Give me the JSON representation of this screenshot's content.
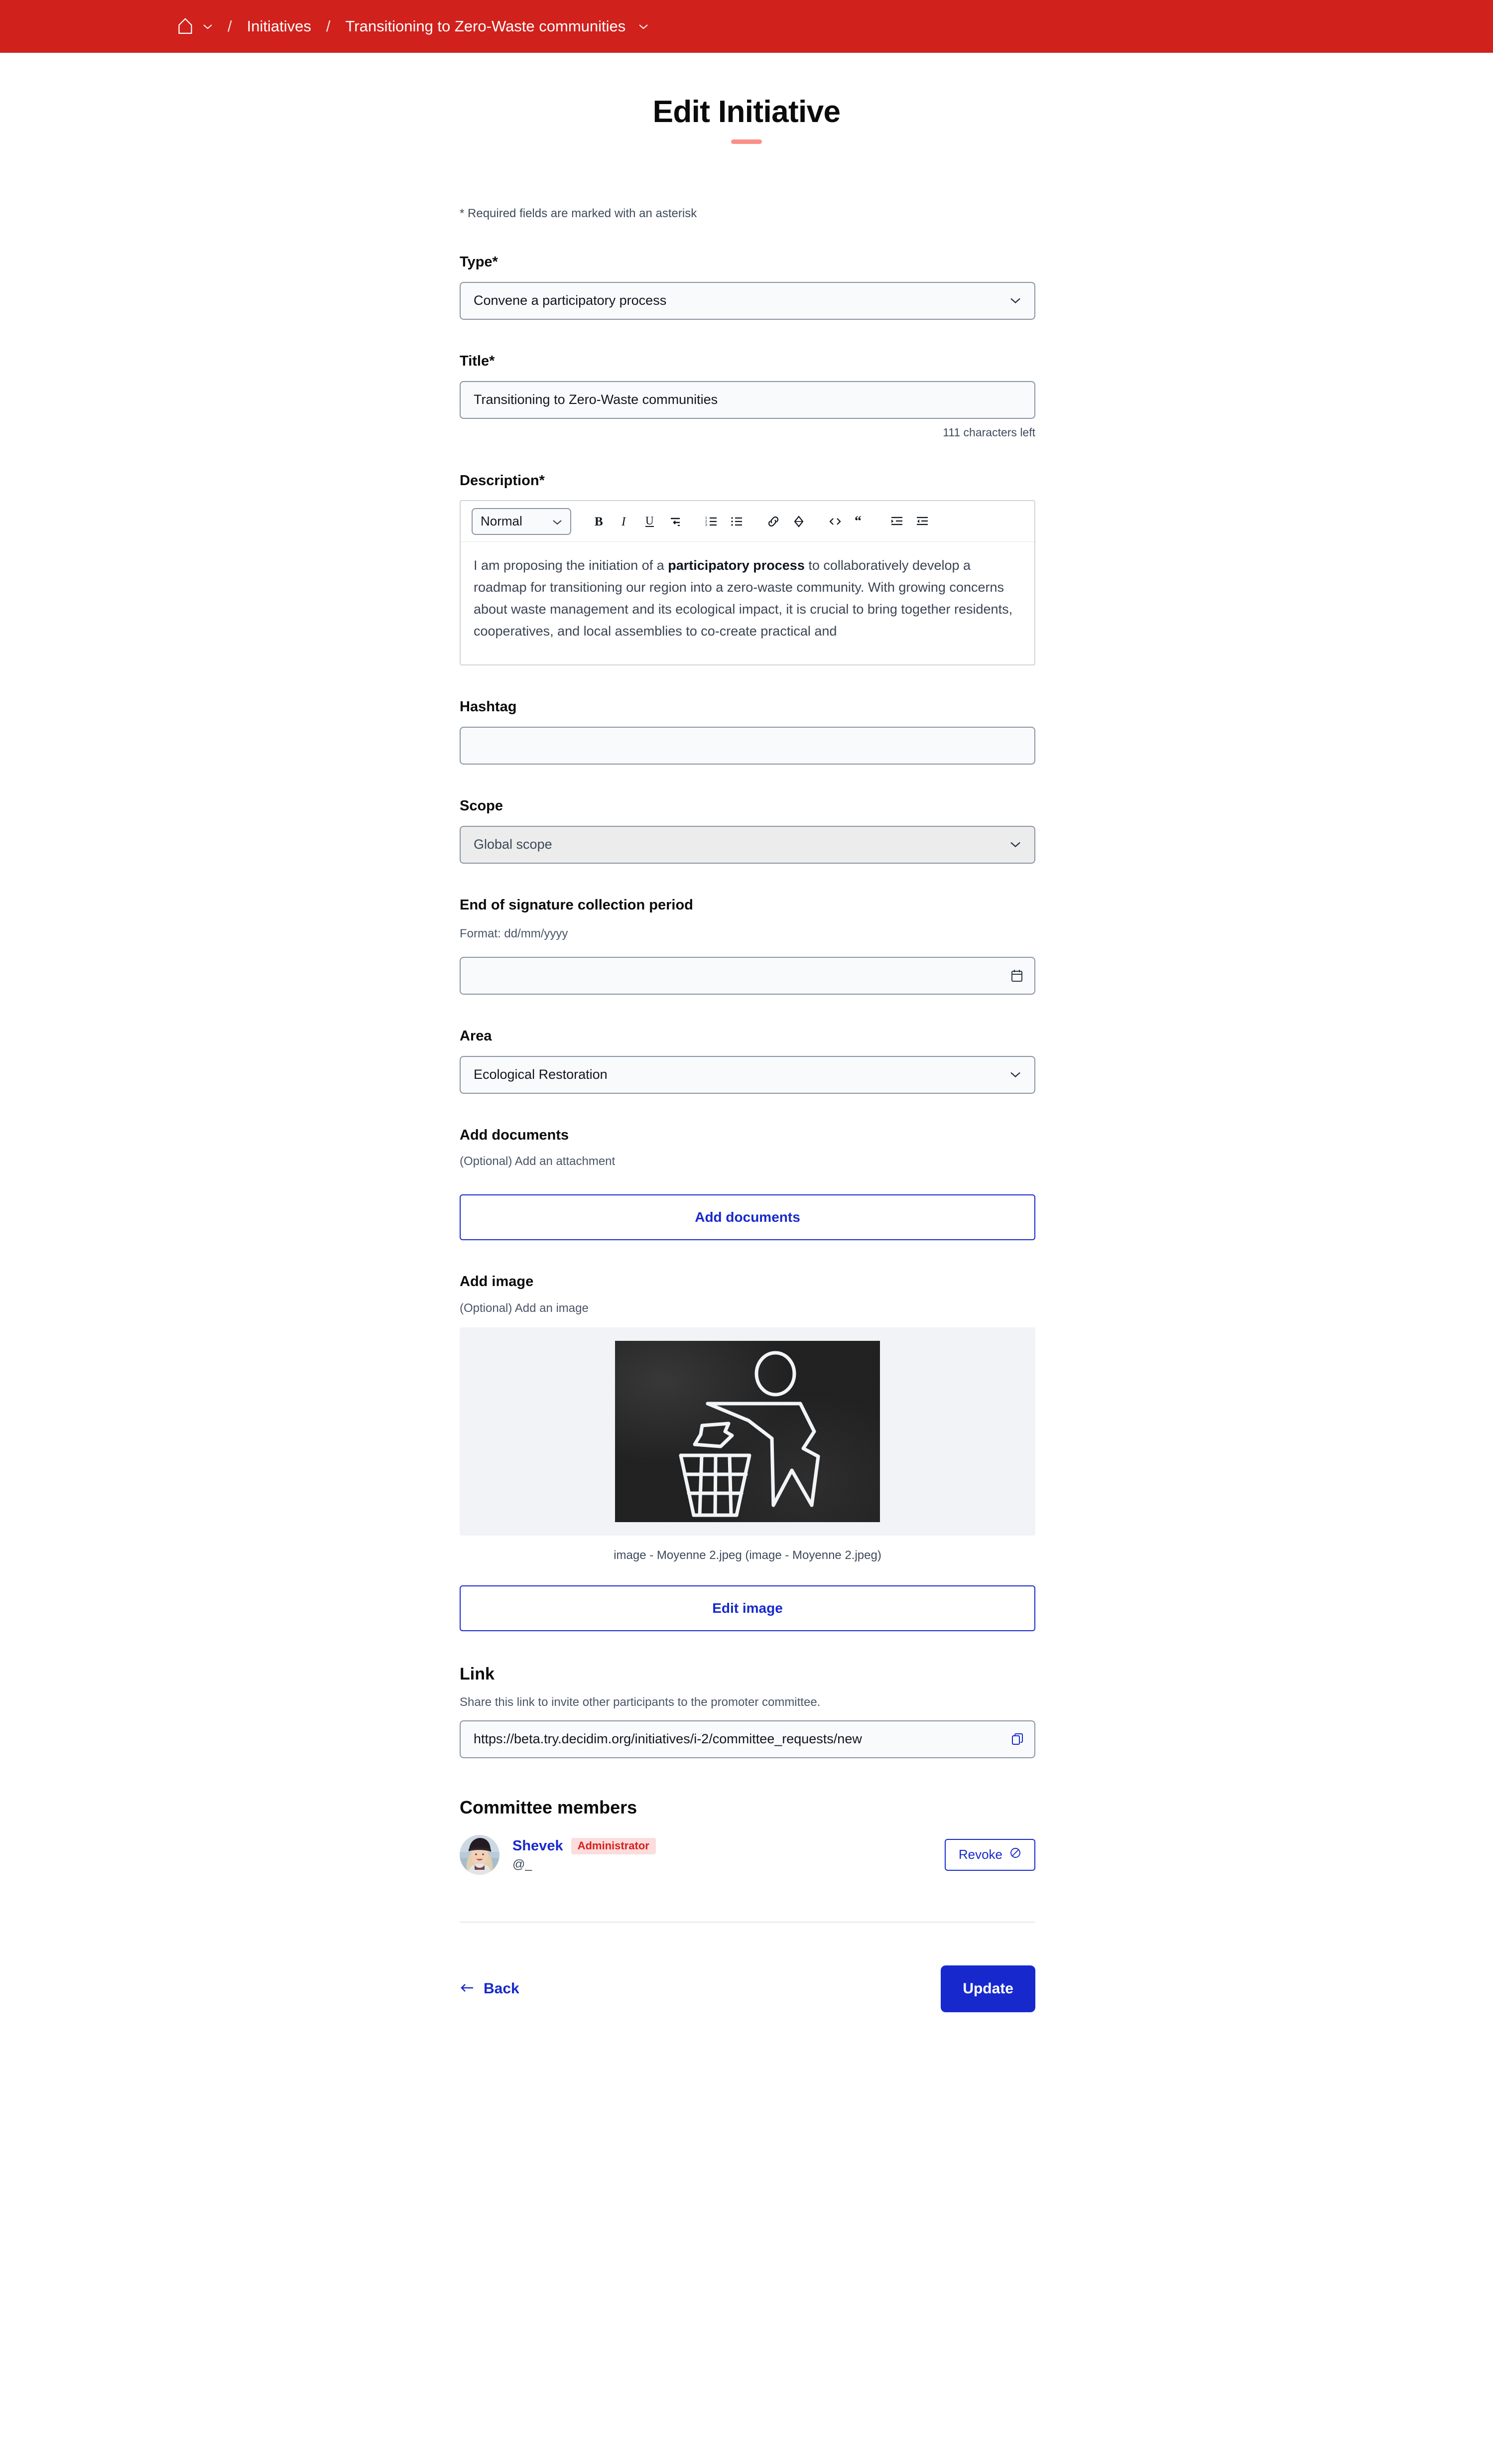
{
  "topbar": {
    "bg_color": "#d0211c",
    "home_icon": "home-icon",
    "home_caret_icon": "chevron-down-icon",
    "separator": "/",
    "breadcrumb_initiatives": "Initiatives",
    "breadcrumb_current": "Transitioning to Zero-Waste communities",
    "current_caret_icon": "chevron-down-icon"
  },
  "page": {
    "title": "Edit Initiative",
    "accent_color": "#fa9088",
    "required_note": "* Required fields are marked with an asterisk"
  },
  "form": {
    "type": {
      "label": "Type*",
      "value": "Convene a participatory process",
      "caret_icon": "chevron-down-icon"
    },
    "title": {
      "label": "Title*",
      "value": "Transitioning to Zero-Waste communities",
      "characters_left": "111 characters left"
    },
    "description": {
      "label": "Description*",
      "format_select": "Normal",
      "format_caret_icon": "chevron-down-icon",
      "toolbar": [
        {
          "name": "bold-icon",
          "glyph": "B"
        },
        {
          "name": "italic-icon",
          "glyph": "I"
        },
        {
          "name": "underline-icon",
          "glyph": "U"
        },
        {
          "name": "line-break-icon",
          "glyph": "↵"
        },
        {
          "name": "ordered-list-icon",
          "glyph": "1."
        },
        {
          "name": "bullet-list-icon",
          "glyph": "•"
        },
        {
          "name": "link-icon",
          "glyph": "🔗"
        },
        {
          "name": "erase-format-icon",
          "glyph": "◇"
        },
        {
          "name": "code-icon",
          "glyph": "<>"
        },
        {
          "name": "blockquote-icon",
          "glyph": "“"
        },
        {
          "name": "indent-icon",
          "glyph": "→|"
        },
        {
          "name": "outdent-icon",
          "glyph": "|←"
        }
      ],
      "body_part1": "I am proposing the initiation of a ",
      "body_bold": "participatory process",
      "body_part2": " to collaboratively develop a roadmap for transitioning our region into a zero-waste community. With growing concerns about waste management and its ecological impact, it is crucial to bring together residents, cooperatives, and local assemblies to co-create practical and"
    },
    "hashtag": {
      "label": "Hashtag",
      "value": ""
    },
    "scope": {
      "label": "Scope",
      "value": "Global scope",
      "caret_icon": "chevron-down-icon",
      "disabled": true
    },
    "signature_end": {
      "label": "End of signature collection period",
      "format_hint": "Format: dd/mm/yyyy",
      "value": "",
      "calendar_icon": "calendar-icon"
    },
    "area": {
      "label": "Area",
      "value": "Ecological Restoration",
      "caret_icon": "chevron-down-icon"
    },
    "documents": {
      "label": "Add documents",
      "hint": "(Optional) Add an attachment",
      "button": "Add documents"
    },
    "image": {
      "label": "Add image",
      "hint": "(Optional) Add an image",
      "caption": "image - Moyenne 2.jpeg (image - Moyenne 2.jpeg)",
      "button": "Edit image",
      "thumbnail_alt": "tidy-man-litter-bin-pictogram"
    },
    "link": {
      "label": "Link",
      "hint": "Share this link to invite other participants to the promoter committee.",
      "value": "https://beta.try.decidim.org/initiatives/i-2/committee_requests/new",
      "copy_icon": "copy-icon"
    }
  },
  "committee": {
    "title": "Committee members",
    "members": [
      {
        "name": "Shevek",
        "badge": "Administrator",
        "handle": "@_",
        "revoke_label": "Revoke",
        "revoke_icon": "forbid-circle-icon",
        "avatar": "avatar"
      }
    ]
  },
  "actions": {
    "back_label": "Back",
    "back_icon": "arrow-left-icon",
    "update_label": "Update",
    "primary_color": "#1729cd"
  }
}
